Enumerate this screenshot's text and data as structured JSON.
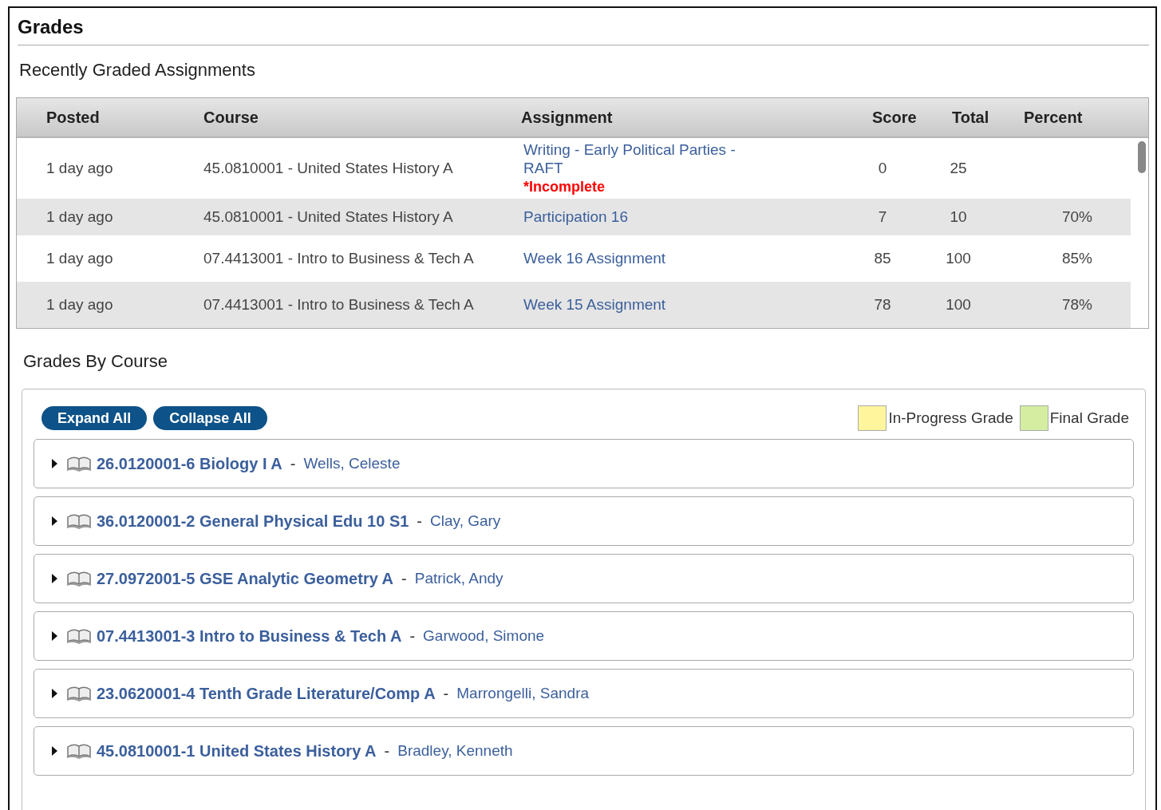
{
  "title": "Grades",
  "recent": {
    "heading": "Recently Graded Assignments",
    "columns": [
      "Posted",
      "Course",
      "Assignment",
      "Score",
      "Total",
      "Percent"
    ],
    "rows": [
      {
        "posted": "1 day ago",
        "course": "45.0810001 - United States History A",
        "assignment": "Writing - Early Political Parties - RAFT",
        "note": "*Incomplete",
        "score": "0",
        "total": "25"
      },
      {
        "posted": "1 day ago",
        "course": "45.0810001 - United States History A",
        "assignment": "Participation 16",
        "score": "7",
        "total": "10",
        "percent": "70%"
      },
      {
        "posted": "1 day ago",
        "course": "07.4413001 - Intro to Business & Tech A",
        "assignment": "Week 16 Assignment",
        "score": "85",
        "total": "100",
        "percent": "85%"
      },
      {
        "posted": "1 day ago",
        "course": "07.4413001 - Intro to Business & Tech A",
        "assignment": "Week 15 Assignment",
        "score": "78",
        "total": "100",
        "percent": "78%"
      }
    ]
  },
  "by_course": {
    "heading": "Grades By Course",
    "buttons": [
      "Expand All",
      "Collapse All"
    ],
    "legend": [
      {
        "label": "In-Progress Grade",
        "color": "#fff59d"
      },
      {
        "label": "Final Grade",
        "color": "#d4eda0"
      }
    ],
    "courses": [
      {
        "name": "26.0120001-6 Biology I A",
        "separator": "-",
        "teacher": "Wells, Celeste",
        "expanded": false
      },
      {
        "name": "36.0120001-2 General Physical Edu 10 S1",
        "separator": "-",
        "teacher": "Clay, Gary",
        "expanded": false
      },
      {
        "name": "27.0972001-5 GSE Analytic Geometry A",
        "separator": "-",
        "teacher": "Patrick, Andy",
        "expanded": false
      },
      {
        "name": "07.4413001-3 Intro to Business & Tech A",
        "separator": "-",
        "teacher": "Garwood, Simone",
        "expanded": false
      },
      {
        "name": "23.0620001-4 Tenth Grade Literature/Comp A",
        "separator": "-",
        "teacher": "Marrongelli, Sandra",
        "expanded": false
      },
      {
        "name": "45.0810001-1 United States History A",
        "separator": "-",
        "teacher": "Bradley, Kenneth",
        "expanded": false
      }
    ]
  }
}
